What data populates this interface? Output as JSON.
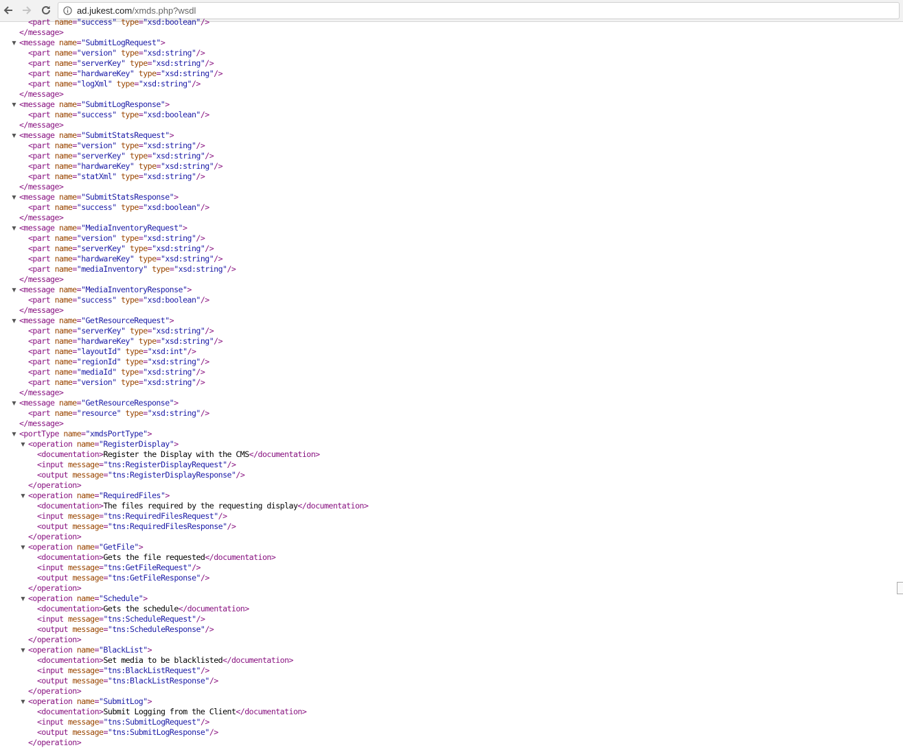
{
  "browser": {
    "url_host": "ad.jukest.com",
    "url_rest": "/xmds.php?wsdl"
  },
  "xml_lines": [
    {
      "d": 1,
      "t": "<part name=\"success\" type=\"xsd:boolean\"/>"
    },
    {
      "d": 0,
      "t": "</message>"
    },
    {
      "d": 0,
      "t": "<message name=\"SubmitLogRequest\">",
      "c": 1
    },
    {
      "d": 1,
      "t": "<part name=\"version\" type=\"xsd:string\"/>"
    },
    {
      "d": 1,
      "t": "<part name=\"serverKey\" type=\"xsd:string\"/>"
    },
    {
      "d": 1,
      "t": "<part name=\"hardwareKey\" type=\"xsd:string\"/>"
    },
    {
      "d": 1,
      "t": "<part name=\"logXml\" type=\"xsd:string\"/>"
    },
    {
      "d": 0,
      "t": "</message>"
    },
    {
      "d": 0,
      "t": "<message name=\"SubmitLogResponse\">",
      "c": 1
    },
    {
      "d": 1,
      "t": "<part name=\"success\" type=\"xsd:boolean\"/>"
    },
    {
      "d": 0,
      "t": "</message>"
    },
    {
      "d": 0,
      "t": "<message name=\"SubmitStatsRequest\">",
      "c": 1
    },
    {
      "d": 1,
      "t": "<part name=\"version\" type=\"xsd:string\"/>"
    },
    {
      "d": 1,
      "t": "<part name=\"serverKey\" type=\"xsd:string\"/>"
    },
    {
      "d": 1,
      "t": "<part name=\"hardwareKey\" type=\"xsd:string\"/>"
    },
    {
      "d": 1,
      "t": "<part name=\"statXml\" type=\"xsd:string\"/>"
    },
    {
      "d": 0,
      "t": "</message>"
    },
    {
      "d": 0,
      "t": "<message name=\"SubmitStatsResponse\">",
      "c": 1
    },
    {
      "d": 1,
      "t": "<part name=\"success\" type=\"xsd:boolean\"/>"
    },
    {
      "d": 0,
      "t": "</message>"
    },
    {
      "d": 0,
      "t": "<message name=\"MediaInventoryRequest\">",
      "c": 1
    },
    {
      "d": 1,
      "t": "<part name=\"version\" type=\"xsd:string\"/>"
    },
    {
      "d": 1,
      "t": "<part name=\"serverKey\" type=\"xsd:string\"/>"
    },
    {
      "d": 1,
      "t": "<part name=\"hardwareKey\" type=\"xsd:string\"/>"
    },
    {
      "d": 1,
      "t": "<part name=\"mediaInventory\" type=\"xsd:string\"/>"
    },
    {
      "d": 0,
      "t": "</message>"
    },
    {
      "d": 0,
      "t": "<message name=\"MediaInventoryResponse\">",
      "c": 1
    },
    {
      "d": 1,
      "t": "<part name=\"success\" type=\"xsd:boolean\"/>"
    },
    {
      "d": 0,
      "t": "</message>"
    },
    {
      "d": 0,
      "t": "<message name=\"GetResourceRequest\">",
      "c": 1
    },
    {
      "d": 1,
      "t": "<part name=\"serverKey\" type=\"xsd:string\"/>"
    },
    {
      "d": 1,
      "t": "<part name=\"hardwareKey\" type=\"xsd:string\"/>"
    },
    {
      "d": 1,
      "t": "<part name=\"layoutId\" type=\"xsd:int\"/>"
    },
    {
      "d": 1,
      "t": "<part name=\"regionId\" type=\"xsd:string\"/>"
    },
    {
      "d": 1,
      "t": "<part name=\"mediaId\" type=\"xsd:string\"/>"
    },
    {
      "d": 1,
      "t": "<part name=\"version\" type=\"xsd:string\"/>"
    },
    {
      "d": 0,
      "t": "</message>"
    },
    {
      "d": 0,
      "t": "<message name=\"GetResourceResponse\">",
      "c": 1
    },
    {
      "d": 1,
      "t": "<part name=\"resource\" type=\"xsd:string\"/>"
    },
    {
      "d": 0,
      "t": "</message>"
    },
    {
      "d": 0,
      "t": "<portType name=\"xmdsPortType\">",
      "c": 1
    },
    {
      "d": 1,
      "t": "<operation name=\"RegisterDisplay\">",
      "c": 1
    },
    {
      "d": 2,
      "t": "<documentation>Register the Display with the CMS</documentation>"
    },
    {
      "d": 2,
      "t": "<input message=\"tns:RegisterDisplayRequest\"/>"
    },
    {
      "d": 2,
      "t": "<output message=\"tns:RegisterDisplayResponse\"/>"
    },
    {
      "d": 1,
      "t": "</operation>"
    },
    {
      "d": 1,
      "t": "<operation name=\"RequiredFiles\">",
      "c": 1
    },
    {
      "d": 2,
      "t": "<documentation>The files required by the requesting display</documentation>"
    },
    {
      "d": 2,
      "t": "<input message=\"tns:RequiredFilesRequest\"/>"
    },
    {
      "d": 2,
      "t": "<output message=\"tns:RequiredFilesResponse\"/>"
    },
    {
      "d": 1,
      "t": "</operation>"
    },
    {
      "d": 1,
      "t": "<operation name=\"GetFile\">",
      "c": 1
    },
    {
      "d": 2,
      "t": "<documentation>Gets the file requested</documentation>"
    },
    {
      "d": 2,
      "t": "<input message=\"tns:GetFileRequest\"/>"
    },
    {
      "d": 2,
      "t": "<output message=\"tns:GetFileResponse\"/>"
    },
    {
      "d": 1,
      "t": "</operation>"
    },
    {
      "d": 1,
      "t": "<operation name=\"Schedule\">",
      "c": 1
    },
    {
      "d": 2,
      "t": "<documentation>Gets the schedule</documentation>"
    },
    {
      "d": 2,
      "t": "<input message=\"tns:ScheduleRequest\"/>"
    },
    {
      "d": 2,
      "t": "<output message=\"tns:ScheduleResponse\"/>"
    },
    {
      "d": 1,
      "t": "</operation>"
    },
    {
      "d": 1,
      "t": "<operation name=\"BlackList\">",
      "c": 1
    },
    {
      "d": 2,
      "t": "<documentation>Set media to be blacklisted</documentation>"
    },
    {
      "d": 2,
      "t": "<input message=\"tns:BlackListRequest\"/>"
    },
    {
      "d": 2,
      "t": "<output message=\"tns:BlackListResponse\"/>"
    },
    {
      "d": 1,
      "t": "</operation>"
    },
    {
      "d": 1,
      "t": "<operation name=\"SubmitLog\">",
      "c": 1
    },
    {
      "d": 2,
      "t": "<documentation>Submit Logging from the Client</documentation>"
    },
    {
      "d": 2,
      "t": "<input message=\"tns:SubmitLogRequest\"/>"
    },
    {
      "d": 2,
      "t": "<output message=\"tns:SubmitLogResponse\"/>"
    },
    {
      "d": 1,
      "t": "</operation>"
    }
  ]
}
